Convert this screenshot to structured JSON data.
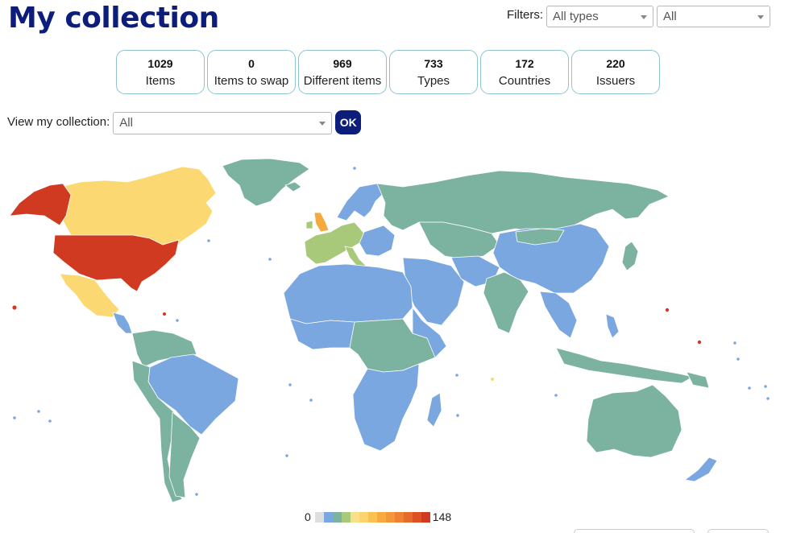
{
  "page": {
    "title": "My collection"
  },
  "filters": {
    "label": "Filters:",
    "type_select": {
      "value": "All types"
    },
    "scope_select": {
      "value": "All"
    }
  },
  "stats": [
    {
      "value": "1029",
      "label": "Items"
    },
    {
      "value": "0",
      "label": "Items to swap"
    },
    {
      "value": "969",
      "label": "Different items"
    },
    {
      "value": "733",
      "label": "Types"
    },
    {
      "value": "172",
      "label": "Countries"
    },
    {
      "value": "220",
      "label": "Issuers"
    }
  ],
  "view": {
    "label": "View my collection:",
    "select_value": "All",
    "ok_label": "OK"
  },
  "legend": {
    "min": "0",
    "max": "148",
    "colors": [
      "#dedede",
      "#7ba7e1",
      "#7bb3a0",
      "#a9c97a",
      "#f7e08a",
      "#fbd46f",
      "#f9c24f",
      "#f5a93e",
      "#f39738",
      "#ee8232",
      "#e66a2a",
      "#dd5225",
      "#cf3a21"
    ]
  },
  "map_colors": {
    "zero": "#dedede",
    "low": "#7ba7e1",
    "low_mid": "#7bb3a0",
    "mid": "#a9c97a",
    "mid_high": "#fbd872",
    "high": "#f5a93e",
    "max": "#cf3a21"
  }
}
